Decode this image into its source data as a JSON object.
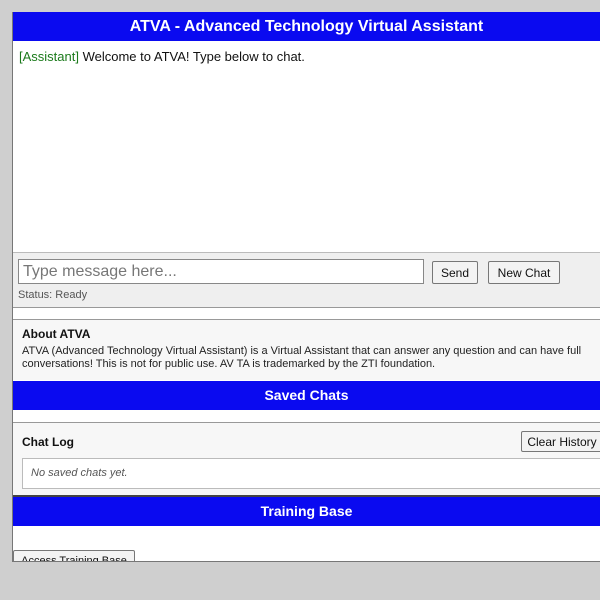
{
  "header": {
    "title": "ATVA - Advanced Technology Virtual Assistant"
  },
  "chat": {
    "messages": [
      {
        "sender": "[Assistant]",
        "text": " Welcome to ATVA! Type below to chat."
      }
    ]
  },
  "input": {
    "placeholder": "Type message here...",
    "value": "",
    "send_label": "Send",
    "new_chat_label": "New Chat",
    "status": "Status: Ready"
  },
  "about": {
    "title": "About ATVA",
    "text": "ATVA (Advanced Technology Virtual Assistant) is a Virtual Assistant that can answer any question and can have full conversations! This is not for public use. AV TA is trademarked by the ZTI foundation."
  },
  "saved": {
    "title": "Saved Chats",
    "log_title": "Chat Log",
    "clear_label": "Clear History",
    "empty_text": "No saved chats yet."
  },
  "training": {
    "title": "Training Base",
    "access_label": "Access Training Base"
  },
  "colors": {
    "header_bar": "#0a0af0",
    "assistant_label": "#1b7a1b",
    "background": "#cfcfcf"
  }
}
